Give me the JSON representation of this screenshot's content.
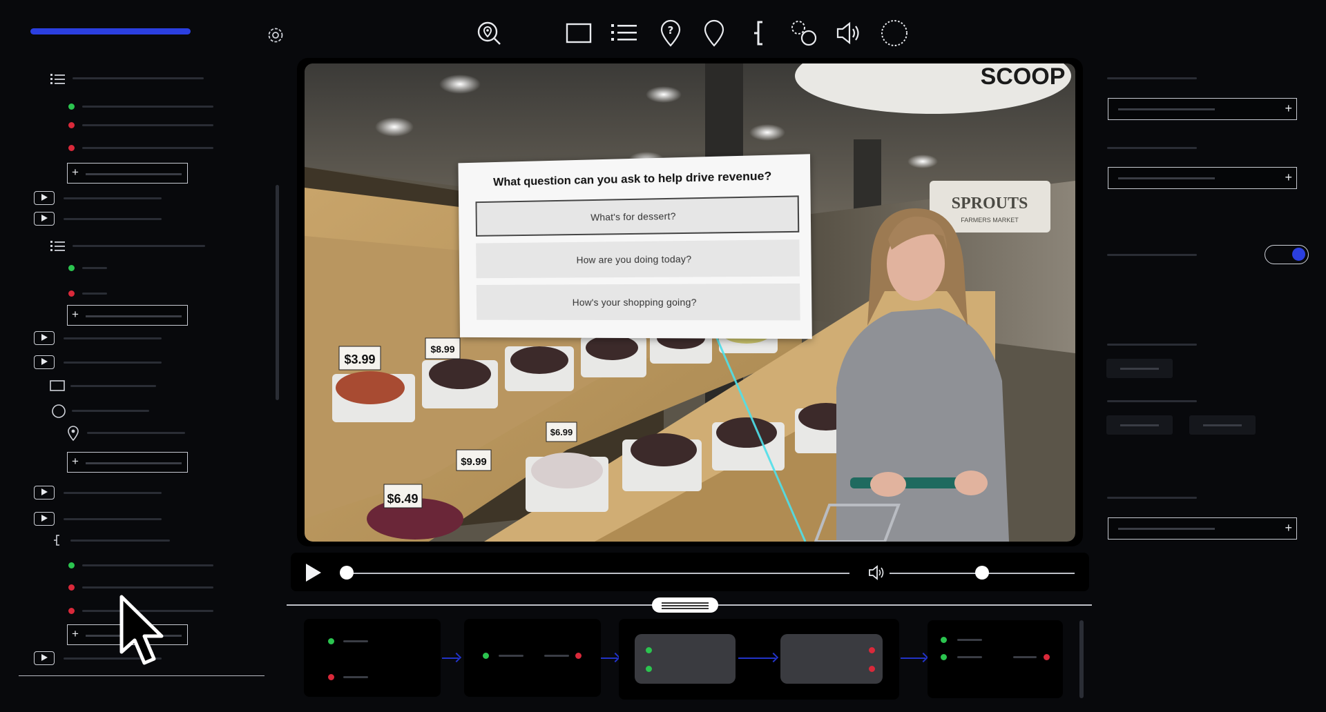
{
  "colors": {
    "accent": "#2b3fe0",
    "green": "#2bc44f",
    "red": "#d9293a",
    "line": "#2233c8"
  },
  "toolbar": {
    "icons": [
      "map-search-icon",
      "rectangle-icon",
      "list-icon",
      "question-pin-icon",
      "location-pin-icon",
      "bracket-icon",
      "circles-icon",
      "speaker-icon",
      "dashed-circle-icon"
    ]
  },
  "question_card": {
    "title": "What question can you ask to help drive revenue?",
    "options": [
      "What's for dessert?",
      "How are you doing today?",
      "How's your shopping going?"
    ]
  },
  "video_scene": {
    "store_sign": "SPROUTS",
    "store_sign_sub": "FARMERS MARKET",
    "scoop_sign": "SCOOP",
    "prices": [
      "$3.99",
      "$6.49",
      "$9.99",
      "$6.99",
      "$8.99"
    ]
  },
  "player": {
    "progress": 0.0,
    "volume": 0.5
  },
  "settings": {
    "toggle_on": true
  }
}
